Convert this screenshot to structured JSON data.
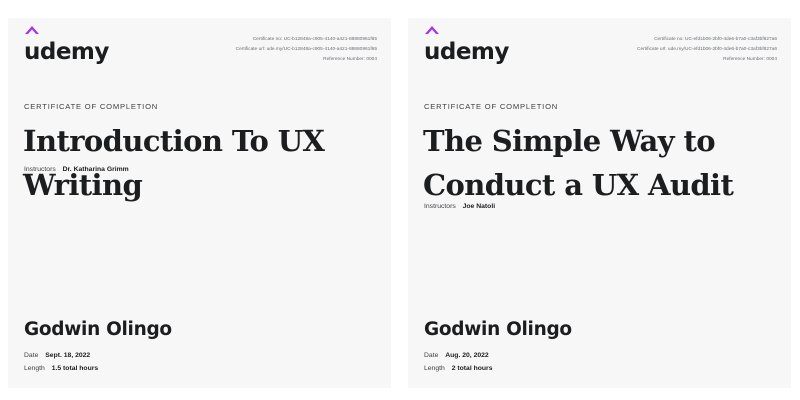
{
  "colors": {
    "brand_purple": "#a435f0",
    "text_dark": "#1c1d1f",
    "text_muted": "#6a6f73",
    "card_background": "#f7f7f8"
  },
  "certificates": [
    {
      "logo_text": "udemy",
      "certificate_no": "Certificate no: UC-b12848a-c905-4140-a421-88880961f65",
      "certificate_url": "Certificate url: ude.my/UC-b12848a-c905-4140-a421-88880961f65",
      "reference_number": "Reference Number: 0004",
      "eyebrow": "Certificate of Completion",
      "course_title": "Introduction To UX Writing",
      "instructors_label": "Instructors",
      "instructor_name": "Dr. Katharina Grimm",
      "student_name": "Godwin Olingo",
      "date_label": "Date",
      "date_value": "Sept. 18, 2022",
      "length_label": "Length",
      "length_value": "1.5 total hours"
    },
    {
      "logo_text": "udemy",
      "certificate_no": "Certificate no: UC-efd1b06-2bf0-4de6-b7a0-c3af3bf827a6",
      "certificate_url": "Certificate url: ude.my/UC-efd1b06-2bf0-4de6-b7a0-c3af3bf827a6",
      "reference_number": "Reference Number: 0004",
      "eyebrow": "Certificate of Completion",
      "course_title": "The Simple Way to Conduct a UX Audit",
      "instructors_label": "Instructors",
      "instructor_name": "Joe Natoli",
      "student_name": "Godwin Olingo",
      "date_label": "Date",
      "date_value": "Aug. 20, 2022",
      "length_label": "Length",
      "length_value": "2 total hours"
    }
  ]
}
